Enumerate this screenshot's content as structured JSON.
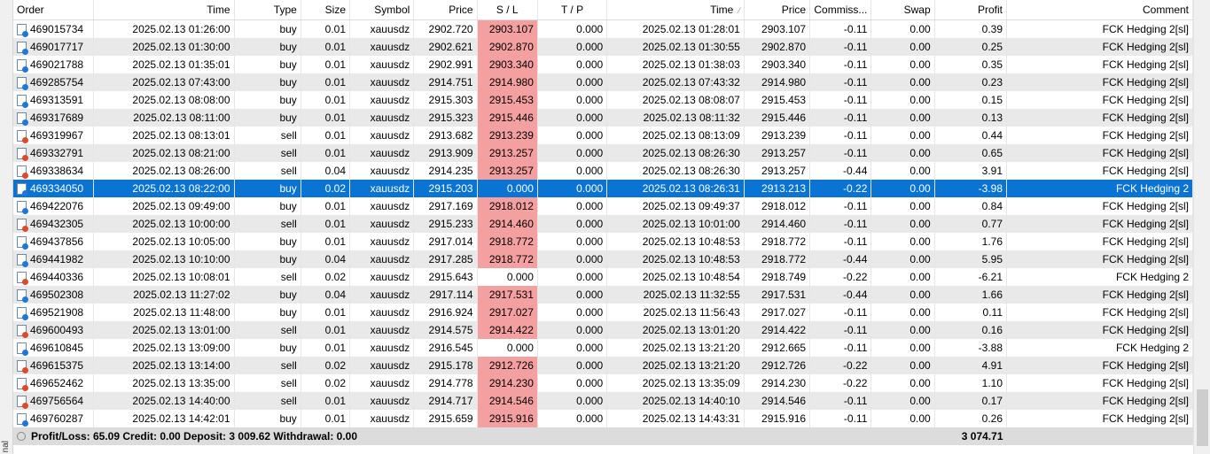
{
  "headers": {
    "order": "Order",
    "time": "Time",
    "type": "Type",
    "size": "Size",
    "symbol": "Symbol",
    "price": "Price",
    "sl": "S / L",
    "tp": "T / P",
    "close_time": "Time",
    "sort_indicator": "⁄",
    "close_price": "Price",
    "commission": "Commiss...",
    "swap": "Swap",
    "profit": "Profit",
    "comment": "Comment"
  },
  "rows": [
    {
      "order": "469015734",
      "time": "2025.02.13 01:26:00",
      "type": "buy",
      "size": "0.01",
      "symbol": "xauusdz",
      "price": "2902.720",
      "sl": "2903.107",
      "tp": "0.000",
      "close_time": "2025.02.13 01:28:01",
      "close_price": "2903.107",
      "commission": "-0.11",
      "swap": "0.00",
      "profit": "0.39",
      "comment": "FCK Hedging 2[sl]"
    },
    {
      "order": "469017717",
      "time": "2025.02.13 01:30:00",
      "type": "buy",
      "size": "0.01",
      "symbol": "xauusdz",
      "price": "2902.621",
      "sl": "2902.870",
      "tp": "0.000",
      "close_time": "2025.02.13 01:30:55",
      "close_price": "2902.870",
      "commission": "-0.11",
      "swap": "0.00",
      "profit": "0.25",
      "comment": "FCK Hedging 2[sl]"
    },
    {
      "order": "469021788",
      "time": "2025.02.13 01:35:01",
      "type": "buy",
      "size": "0.01",
      "symbol": "xauusdz",
      "price": "2902.991",
      "sl": "2903.340",
      "tp": "0.000",
      "close_time": "2025.02.13 01:38:03",
      "close_price": "2903.340",
      "commission": "-0.11",
      "swap": "0.00",
      "profit": "0.35",
      "comment": "FCK Hedging 2[sl]"
    },
    {
      "order": "469285754",
      "time": "2025.02.13 07:43:00",
      "type": "buy",
      "size": "0.01",
      "symbol": "xauusdz",
      "price": "2914.751",
      "sl": "2914.980",
      "tp": "0.000",
      "close_time": "2025.02.13 07:43:32",
      "close_price": "2914.980",
      "commission": "-0.11",
      "swap": "0.00",
      "profit": "0.23",
      "comment": "FCK Hedging 2[sl]"
    },
    {
      "order": "469313591",
      "time": "2025.02.13 08:08:00",
      "type": "buy",
      "size": "0.01",
      "symbol": "xauusdz",
      "price": "2915.303",
      "sl": "2915.453",
      "tp": "0.000",
      "close_time": "2025.02.13 08:08:07",
      "close_price": "2915.453",
      "commission": "-0.11",
      "swap": "0.00",
      "profit": "0.15",
      "comment": "FCK Hedging 2[sl]"
    },
    {
      "order": "469317689",
      "time": "2025.02.13 08:11:00",
      "type": "buy",
      "size": "0.01",
      "symbol": "xauusdz",
      "price": "2915.323",
      "sl": "2915.446",
      "tp": "0.000",
      "close_time": "2025.02.13 08:11:32",
      "close_price": "2915.446",
      "commission": "-0.11",
      "swap": "0.00",
      "profit": "0.13",
      "comment": "FCK Hedging 2[sl]"
    },
    {
      "order": "469319967",
      "time": "2025.02.13 08:13:01",
      "type": "sell",
      "size": "0.01",
      "symbol": "xauusdz",
      "price": "2913.682",
      "sl": "2913.239",
      "tp": "0.000",
      "close_time": "2025.02.13 08:13:09",
      "close_price": "2913.239",
      "commission": "-0.11",
      "swap": "0.00",
      "profit": "0.44",
      "comment": "FCK Hedging 2[sl]"
    },
    {
      "order": "469332791",
      "time": "2025.02.13 08:21:00",
      "type": "sell",
      "size": "0.01",
      "symbol": "xauusdz",
      "price": "2913.909",
      "sl": "2913.257",
      "tp": "0.000",
      "close_time": "2025.02.13 08:26:30",
      "close_price": "2913.257",
      "commission": "-0.11",
      "swap": "0.00",
      "profit": "0.65",
      "comment": "FCK Hedging 2[sl]"
    },
    {
      "order": "469338634",
      "time": "2025.02.13 08:26:00",
      "type": "sell",
      "size": "0.04",
      "symbol": "xauusdz",
      "price": "2914.235",
      "sl": "2913.257",
      "tp": "0.000",
      "close_time": "2025.02.13 08:26:30",
      "close_price": "2913.257",
      "commission": "-0.44",
      "swap": "0.00",
      "profit": "3.91",
      "comment": "FCK Hedging 2[sl]"
    },
    {
      "order": "469334050",
      "time": "2025.02.13 08:22:00",
      "type": "buy",
      "size": "0.02",
      "symbol": "xauusdz",
      "price": "2915.203",
      "sl": "0.000",
      "tp": "0.000",
      "close_time": "2025.02.13 08:26:31",
      "close_price": "2913.213",
      "commission": "-0.22",
      "swap": "0.00",
      "profit": "-3.98",
      "comment": "FCK Hedging 2",
      "selected": true
    },
    {
      "order": "469422076",
      "time": "2025.02.13 09:49:00",
      "type": "buy",
      "size": "0.01",
      "symbol": "xauusdz",
      "price": "2917.169",
      "sl": "2918.012",
      "tp": "0.000",
      "close_time": "2025.02.13 09:49:37",
      "close_price": "2918.012",
      "commission": "-0.11",
      "swap": "0.00",
      "profit": "0.84",
      "comment": "FCK Hedging 2[sl]"
    },
    {
      "order": "469432305",
      "time": "2025.02.13 10:00:00",
      "type": "sell",
      "size": "0.01",
      "symbol": "xauusdz",
      "price": "2915.233",
      "sl": "2914.460",
      "tp": "0.000",
      "close_time": "2025.02.13 10:01:00",
      "close_price": "2914.460",
      "commission": "-0.11",
      "swap": "0.00",
      "profit": "0.77",
      "comment": "FCK Hedging 2[sl]"
    },
    {
      "order": "469437856",
      "time": "2025.02.13 10:05:00",
      "type": "buy",
      "size": "0.01",
      "symbol": "xauusdz",
      "price": "2917.014",
      "sl": "2918.772",
      "tp": "0.000",
      "close_time": "2025.02.13 10:48:53",
      "close_price": "2918.772",
      "commission": "-0.11",
      "swap": "0.00",
      "profit": "1.76",
      "comment": "FCK Hedging 2[sl]"
    },
    {
      "order": "469441982",
      "time": "2025.02.13 10:10:00",
      "type": "buy",
      "size": "0.04",
      "symbol": "xauusdz",
      "price": "2917.285",
      "sl": "2918.772",
      "tp": "0.000",
      "close_time": "2025.02.13 10:48:53",
      "close_price": "2918.772",
      "commission": "-0.44",
      "swap": "0.00",
      "profit": "5.95",
      "comment": "FCK Hedging 2[sl]"
    },
    {
      "order": "469440336",
      "time": "2025.02.13 10:08:01",
      "type": "sell",
      "size": "0.02",
      "symbol": "xauusdz",
      "price": "2915.643",
      "sl": "0.000",
      "tp": "0.000",
      "close_time": "2025.02.13 10:48:54",
      "close_price": "2918.749",
      "commission": "-0.22",
      "swap": "0.00",
      "profit": "-6.21",
      "comment": "FCK Hedging 2"
    },
    {
      "order": "469502308",
      "time": "2025.02.13 11:27:02",
      "type": "buy",
      "size": "0.04",
      "symbol": "xauusdz",
      "price": "2917.114",
      "sl": "2917.531",
      "tp": "0.000",
      "close_time": "2025.02.13 11:32:55",
      "close_price": "2917.531",
      "commission": "-0.44",
      "swap": "0.00",
      "profit": "1.66",
      "comment": "FCK Hedging 2[sl]"
    },
    {
      "order": "469521908",
      "time": "2025.02.13 11:48:00",
      "type": "buy",
      "size": "0.01",
      "symbol": "xauusdz",
      "price": "2916.924",
      "sl": "2917.027",
      "tp": "0.000",
      "close_time": "2025.02.13 11:56:43",
      "close_price": "2917.027",
      "commission": "-0.11",
      "swap": "0.00",
      "profit": "0.11",
      "comment": "FCK Hedging 2[sl]"
    },
    {
      "order": "469600493",
      "time": "2025.02.13 13:01:00",
      "type": "sell",
      "size": "0.01",
      "symbol": "xauusdz",
      "price": "2914.575",
      "sl": "2914.422",
      "tp": "0.000",
      "close_time": "2025.02.13 13:01:20",
      "close_price": "2914.422",
      "commission": "-0.11",
      "swap": "0.00",
      "profit": "0.16",
      "comment": "FCK Hedging 2[sl]"
    },
    {
      "order": "469610845",
      "time": "2025.02.13 13:09:00",
      "type": "buy",
      "size": "0.01",
      "symbol": "xauusdz",
      "price": "2916.545",
      "sl": "0.000",
      "tp": "0.000",
      "close_time": "2025.02.13 13:21:20",
      "close_price": "2912.665",
      "commission": "-0.11",
      "swap": "0.00",
      "profit": "-3.88",
      "comment": "FCK Hedging 2"
    },
    {
      "order": "469615375",
      "time": "2025.02.13 13:14:00",
      "type": "sell",
      "size": "0.02",
      "symbol": "xauusdz",
      "price": "2915.178",
      "sl": "2912.726",
      "tp": "0.000",
      "close_time": "2025.02.13 13:21:20",
      "close_price": "2912.726",
      "commission": "-0.22",
      "swap": "0.00",
      "profit": "4.91",
      "comment": "FCK Hedging 2[sl]"
    },
    {
      "order": "469652462",
      "time": "2025.02.13 13:35:00",
      "type": "sell",
      "size": "0.02",
      "symbol": "xauusdz",
      "price": "2914.778",
      "sl": "2914.230",
      "tp": "0.000",
      "close_time": "2025.02.13 13:35:09",
      "close_price": "2914.230",
      "commission": "-0.22",
      "swap": "0.00",
      "profit": "1.10",
      "comment": "FCK Hedging 2[sl]"
    },
    {
      "order": "469756564",
      "time": "2025.02.13 14:40:00",
      "type": "sell",
      "size": "0.01",
      "symbol": "xauusdz",
      "price": "2914.717",
      "sl": "2914.546",
      "tp": "0.000",
      "close_time": "2025.02.13 14:40:10",
      "close_price": "2914.546",
      "commission": "-0.11",
      "swap": "0.00",
      "profit": "0.17",
      "comment": "FCK Hedging 2[sl]"
    },
    {
      "order": "469760287",
      "time": "2025.02.13 14:42:01",
      "type": "buy",
      "size": "0.01",
      "symbol": "xauusdz",
      "price": "2915.659",
      "sl": "2915.916",
      "tp": "0.000",
      "close_time": "2025.02.13 14:43:31",
      "close_price": "2915.916",
      "commission": "-0.11",
      "swap": "0.00",
      "profit": "0.26",
      "comment": "FCK Hedging 2[sl]"
    }
  ],
  "summary": {
    "text": "Profit/Loss: 65.09  Credit: 0.00  Deposit: 3 009.62  Withdrawal: 0.00",
    "balance": "3 074.71"
  },
  "side_tab": "nal",
  "colors": {
    "selection": "#0a74d4",
    "sl_highlight": "#f4a0a0",
    "buy_dot": "#1e78d8",
    "sell_dot": "#e0492a"
  }
}
